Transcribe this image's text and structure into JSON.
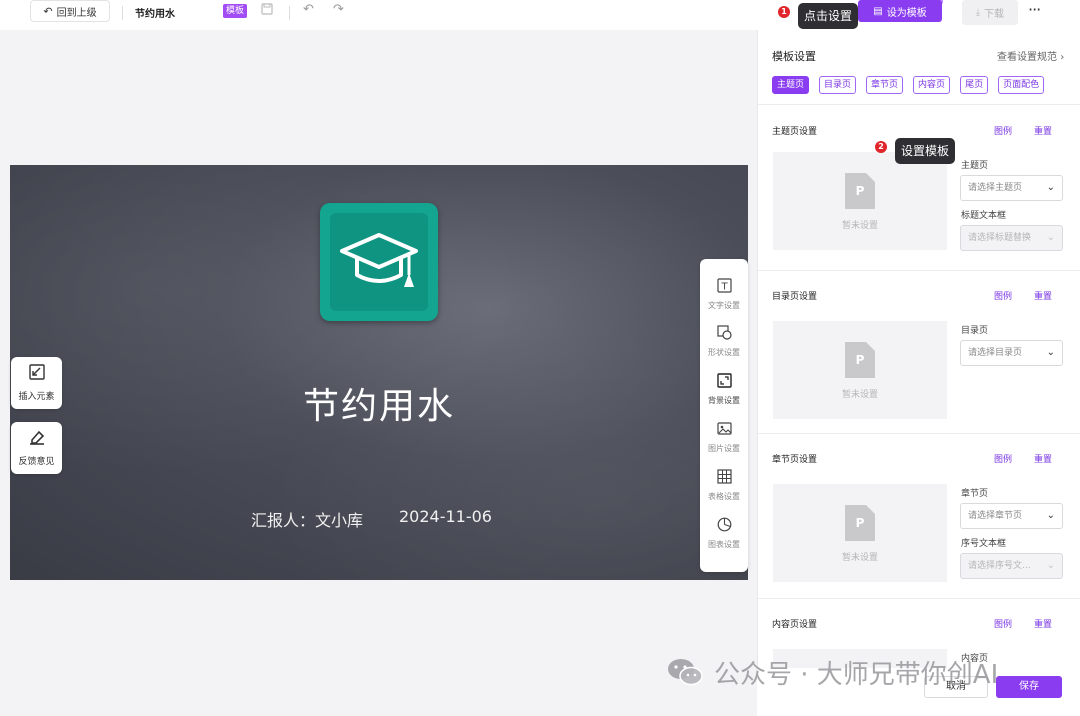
{
  "toolbar": {
    "back_label": "回到上级",
    "doc_title": "节约用水",
    "template_badge": "模板",
    "set_template_label": "设为模板",
    "download_label": "下载",
    "more": "···"
  },
  "tips": {
    "tip1_num": "1",
    "tip1_text": "点击设置",
    "tip2_num": "2",
    "tip2_text": "设置模板"
  },
  "slide": {
    "title": "节约用水",
    "reporter": "汇报人：文小库",
    "date": "2024-11-06",
    "logo_color": "#14a590"
  },
  "left_tools": [
    {
      "label": "插入元素",
      "icon": "insert-element-icon"
    },
    {
      "label": "反馈意见",
      "icon": "feedback-icon"
    }
  ],
  "right_tools": [
    {
      "label": "文字设置",
      "icon": "text-icon"
    },
    {
      "label": "形状设置",
      "icon": "shape-icon"
    },
    {
      "label": "背景设置",
      "icon": "background-icon"
    },
    {
      "label": "图片设置",
      "icon": "image-icon"
    },
    {
      "label": "表格设置",
      "icon": "table-icon"
    },
    {
      "label": "图表设置",
      "icon": "chart-icon"
    }
  ],
  "panel": {
    "title": "模板设置",
    "link": "查看设置规范",
    "tabs": [
      "主题页",
      "目录页",
      "章节页",
      "内容页",
      "尾页",
      "页面配色"
    ],
    "active_tab": "主题页",
    "legend": "图例",
    "reset": "重置",
    "empty_text": "暂未设置",
    "sections": [
      {
        "title": "主题页设置",
        "field1_label": "主题页",
        "field1_placeholder": "请选择主题页",
        "field2_label": "标题文本框",
        "field2_placeholder": "请选择标题替换"
      },
      {
        "title": "目录页设置",
        "field1_label": "目录页",
        "field1_placeholder": "请选择目录页"
      },
      {
        "title": "章节页设置",
        "field1_label": "章节页",
        "field1_placeholder": "请选择章节页",
        "field2_label": "序号文本框",
        "field2_placeholder": "请选择序号文..."
      },
      {
        "title": "内容页设置",
        "field1_label": "内容页"
      }
    ],
    "cancel": "取消",
    "save": "保存"
  },
  "watermark": "公众号 · 大师兄带你创AI",
  "colors": {
    "accent": "#8a3df0",
    "tip_bg": "#2f2f33",
    "tip_badge": "#e0252b"
  }
}
